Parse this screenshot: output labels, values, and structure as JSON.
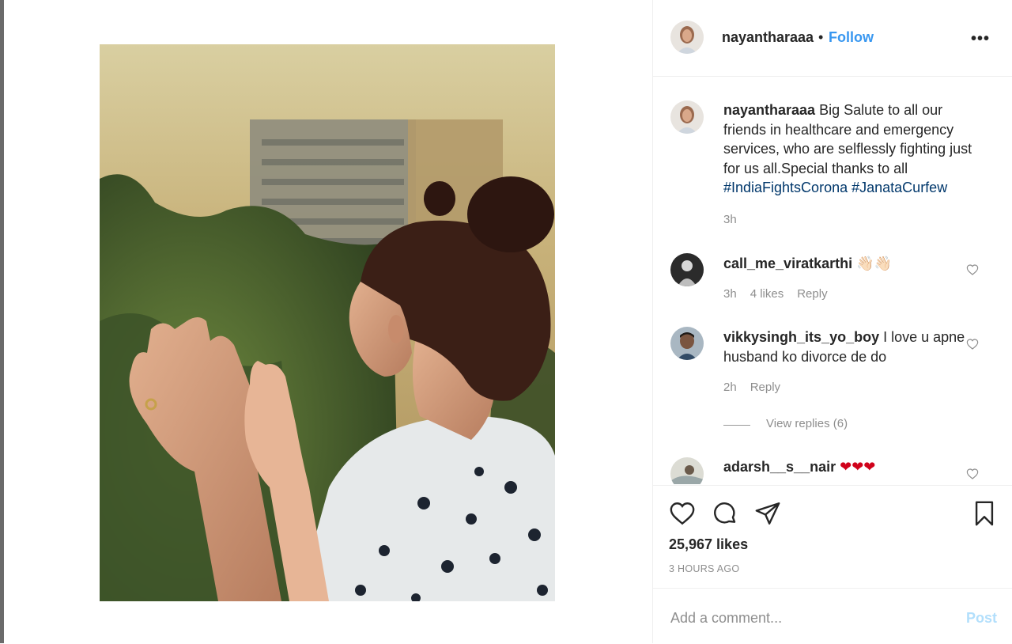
{
  "post": {
    "username": "nayantharaaa",
    "follow_label": "Follow",
    "separator": "•",
    "more_label": "•••"
  },
  "caption": {
    "username": "nayantharaaa",
    "text": " Big Salute to all our friends in healthcare and emergency services, who are selflessly fighting just for us all.Special thanks to all ",
    "hashtags": [
      "#IndiaFightsCorona",
      "#JanataCurfew"
    ],
    "time": "3h"
  },
  "comments": [
    {
      "username": "call_me_viratkarthi",
      "text": "👋🏻👋🏻",
      "time": "3h",
      "likes": "4 likes",
      "reply": "Reply"
    },
    {
      "username": "vikkysingh_its_yo_boy",
      "text": " I love u apne husband ko divorce de do",
      "time": "2h",
      "reply": "Reply",
      "view_replies": "View replies (6)"
    },
    {
      "username": "adarsh__s__nair",
      "text": "❤❤❤"
    }
  ],
  "engagement": {
    "likes": "25,967 likes",
    "time_ago": "3 HOURS AGO"
  },
  "add_comment": {
    "placeholder": "Add a comment...",
    "post_label": "Post"
  },
  "icons": {
    "like": "heart-icon",
    "comment": "comment-bubble-icon",
    "share": "paper-plane-icon",
    "save": "bookmark-icon",
    "more": "ellipsis-icon"
  },
  "colors": {
    "link_blue": "#3897f0",
    "hashtag_blue": "#00376b",
    "muted": "#8e8e8e",
    "heart_red": "#d0021b",
    "post_disabled": "#b2dffc"
  }
}
